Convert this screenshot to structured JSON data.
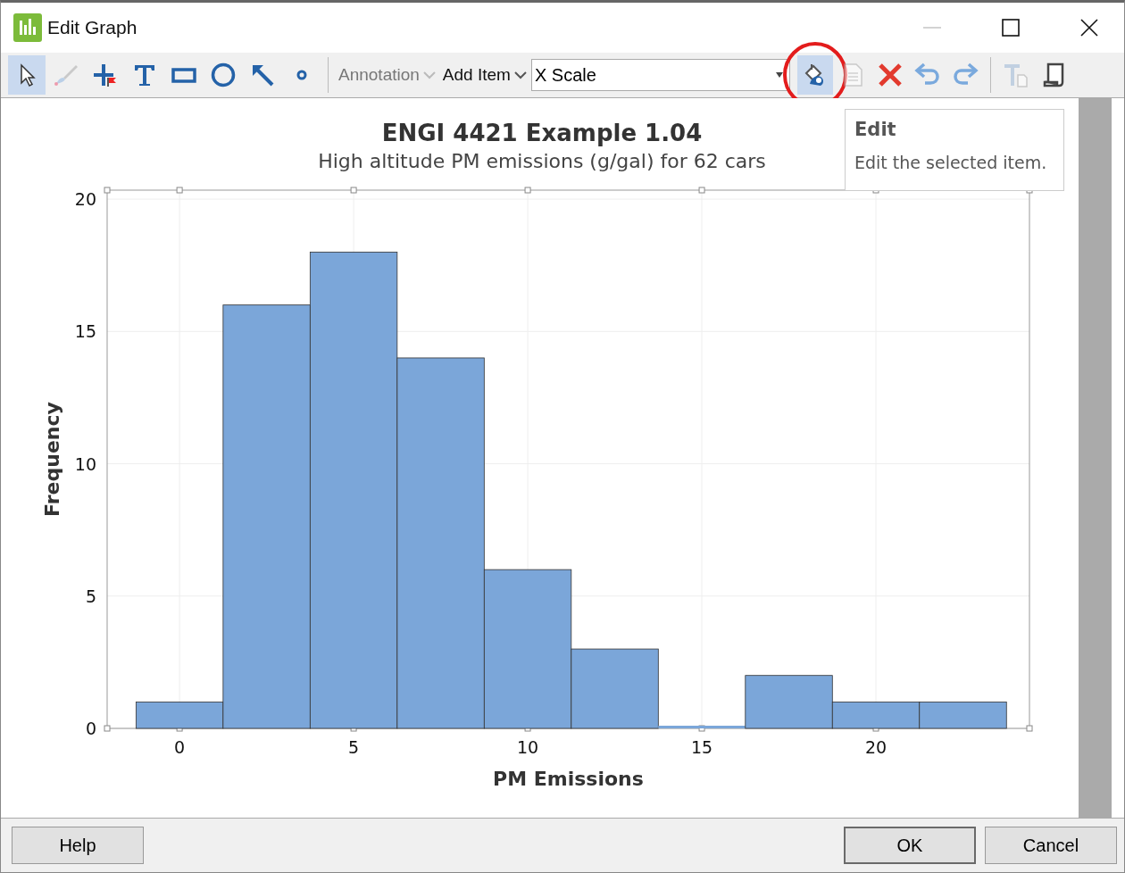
{
  "window": {
    "title": "Edit Graph"
  },
  "toolbar": {
    "tools": [
      {
        "kind": "pointer",
        "selected": true,
        "disabled": false
      },
      {
        "kind": "brush",
        "selected": false,
        "disabled": true
      },
      {
        "kind": "crosshair",
        "selected": false,
        "disabled": false
      },
      {
        "kind": "text",
        "selected": false,
        "disabled": false
      },
      {
        "kind": "rectangle",
        "selected": false,
        "disabled": false
      },
      {
        "kind": "ellipse",
        "selected": false,
        "disabled": false
      },
      {
        "kind": "arrow",
        "selected": false,
        "disabled": false
      },
      {
        "kind": "point",
        "selected": false,
        "disabled": false
      }
    ],
    "menus": [
      {
        "label": "Annotation",
        "disabled": true
      },
      {
        "label": "Add Item",
        "disabled": false
      }
    ],
    "item_selector": {
      "value": "X Scale"
    },
    "actions": [
      {
        "kind": "edit",
        "selected": true,
        "disabled": false,
        "circled": true
      },
      {
        "kind": "document",
        "selected": false,
        "disabled": true,
        "circled": false
      },
      {
        "kind": "delete",
        "selected": false,
        "disabled": false,
        "circled": false
      },
      {
        "kind": "undo",
        "selected": false,
        "disabled": false,
        "circled": false
      },
      {
        "kind": "redo",
        "selected": false,
        "disabled": false,
        "circled": false
      },
      {
        "kind": "text-format",
        "selected": false,
        "disabled": true,
        "circled": false
      },
      {
        "kind": "scroll",
        "selected": false,
        "disabled": false,
        "circled": false
      }
    ]
  },
  "tooltip": {
    "title": "Edit",
    "text": "Edit the selected item."
  },
  "graph": {
    "chart_data": {
      "type": "bar",
      "title": "ENGI 4421 Example 1.04",
      "subtitle": "High altitude PM emissions (g/gal) for 62 cars",
      "xlabel": "PM Emissions",
      "ylabel": "Frequency",
      "x": [
        0,
        2.5,
        5,
        7.5,
        10,
        12.5,
        15,
        17.5,
        20,
        22.5
      ],
      "values": [
        1,
        16,
        18,
        14,
        6,
        3,
        0,
        2,
        1,
        1
      ],
      "color": "#7ba6d9",
      "grid": true,
      "xlim": [
        -2.08,
        24.41
      ],
      "ylim": [
        0,
        20.34
      ],
      "xticks": [
        0,
        5,
        10,
        15,
        20
      ],
      "yticks": [
        0,
        5,
        10,
        15,
        20
      ]
    }
  },
  "buttons": [
    {
      "label": "Help"
    },
    {
      "label": "OK"
    },
    {
      "label": "Cancel"
    }
  ]
}
